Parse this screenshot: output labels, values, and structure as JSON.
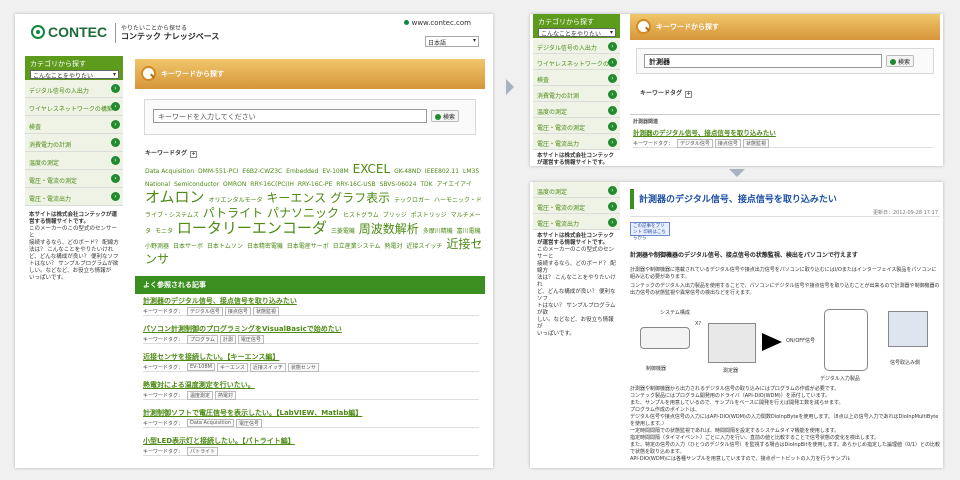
{
  "brand": {
    "logo": "CONTEC",
    "tagline_small": "やりたいことから探せる",
    "tagline": "コンテック ナレッジベース",
    "url": "www.contec.com",
    "language": "日本語"
  },
  "sidebar": {
    "title": "カテゴリから探す",
    "select": "こんなことをやりたい",
    "items": [
      "デジタル信号の入出力",
      "ワイヤレスネットワークの構築",
      "検査",
      "消費電力の計測",
      "温度の測定",
      "電圧・電流の測定",
      "電圧・電流出力"
    ],
    "about_title": "本サイトは株式会社コンテックが運営する情報サイトです。",
    "about_lines": [
      "このメーカーのこの型式のセンサーと",
      "接続するなら、どのボード？ 配線方",
      "法は？ こんなことをやりたいけれ",
      "ど、どんな構成が良い？ 便利なソフ",
      "トはない？ サンプルプログラムが欲",
      "しい。などなど、お役立ち情報が",
      "いっぱいです。"
    ]
  },
  "search": {
    "title": "キーワードから探す",
    "placeholder": "キーワードを入力してください",
    "button": "検索",
    "s2_value": "計測器",
    "tag_heading": "キーワードタグ",
    "toggle": "+"
  },
  "tag_cloud": [
    {
      "t": "Data Acquisition",
      "s": 1
    },
    {
      "t": "DMM-551-PCI",
      "s": 1
    },
    {
      "t": "E6B2-CWZ3C",
      "s": 1
    },
    {
      "t": "Embedded",
      "s": 1
    },
    {
      "t": "EV-108M",
      "s": 1
    },
    {
      "t": "EXCEL",
      "s": 3
    },
    {
      "t": "GK-48ND",
      "s": 1
    },
    {
      "t": "IEEE802.11",
      "s": 1
    },
    {
      "t": "LM35",
      "s": 1
    },
    {
      "t": "National",
      "s": 1
    },
    {
      "t": "Semiconductor",
      "s": 1
    },
    {
      "t": "OMRON",
      "s": 1
    },
    {
      "t": "RRY-16C(PCI)H",
      "s": 1
    },
    {
      "t": "RRY-16C-PE",
      "s": 1
    },
    {
      "t": "RRY-16C-USB",
      "s": 1
    },
    {
      "t": "SBVS-06024",
      "s": 1
    },
    {
      "t": "TDK",
      "s": 1
    },
    {
      "t": "アイエイアイ",
      "s": 1
    },
    {
      "t": "オムロン",
      "s": 4
    },
    {
      "t": "オリエンタルモータ",
      "s": 1
    },
    {
      "t": "キーエンス",
      "s": 3
    },
    {
      "t": "グラフ表示",
      "s": 3
    },
    {
      "t": "テックロガー",
      "s": 1
    },
    {
      "t": "ハーモニック・ドライブ・システムズ",
      "s": 1
    },
    {
      "t": "パトライト",
      "s": 3
    },
    {
      "t": "パナソニック",
      "s": 3
    },
    {
      "t": "ヒストグラム",
      "s": 1
    },
    {
      "t": "ブリッジ",
      "s": 1
    },
    {
      "t": "ポストリッジ",
      "s": 1
    },
    {
      "t": "マルチメータ",
      "s": 1
    },
    {
      "t": "モニタ",
      "s": 1
    },
    {
      "t": "ロータリーエンコーダ",
      "s": 4
    },
    {
      "t": "三菱電機",
      "s": 1
    },
    {
      "t": "周波数解析",
      "s": 3
    },
    {
      "t": "多摩川精機",
      "s": 1
    },
    {
      "t": "富川電機",
      "s": 1
    },
    {
      "t": "小野測器",
      "s": 1
    },
    {
      "t": "日本サーボ",
      "s": 1
    },
    {
      "t": "日本トムソン",
      "s": 1
    },
    {
      "t": "日本精密電機",
      "s": 1
    },
    {
      "t": "日本電産サーボ",
      "s": 1
    },
    {
      "t": "日立産業システム",
      "s": 1
    },
    {
      "t": "熱電対",
      "s": 1
    },
    {
      "t": "近接スイッチ",
      "s": 1
    },
    {
      "t": "近接センサ",
      "s": 3
    }
  ],
  "popular": {
    "heading": "よく参照される記事",
    "tag_label": "キーワードタグ：",
    "articles": [
      {
        "title": "計測器のデジタル信号、接点信号を取り込みたい",
        "tags": [
          "デジタル信号",
          "接点信号",
          "状態監視"
        ]
      },
      {
        "title": "パソコン計測制御のプログラミングをVisualBasicで始めたい",
        "tags": [
          "プログラム",
          "計測",
          "電圧信号"
        ]
      },
      {
        "title": "近接センサを接続したい。【キーエンス編】",
        "tags": [
          "EV-108M",
          "キーエンス",
          "近接スイッチ",
          "状態センサ"
        ]
      },
      {
        "title": "熱電対による温度測定を行いたい。",
        "tags": [
          "温度測定",
          "熱電対"
        ]
      },
      {
        "title": "計測制御ソフトで電圧信号を表示したい。【LabVIEW、Matlab編】",
        "tags": [
          "Data Acquisition",
          "電圧信号"
        ]
      },
      {
        "title": "小型LED表示灯と接続したい。【パトライト編】",
        "tags": [
          "パトライト"
        ]
      }
    ]
  },
  "result_list": {
    "header": "計測器関連",
    "title": "計測器のデジタル信号、接点信号を取り込みたい",
    "tags": [
      "デジタル信号",
      "接点信号",
      "状態監視"
    ]
  },
  "article": {
    "title": "計測器のデジタル信号、接点信号を取り込みたい",
    "date": "更新日：2012-09-28 17:17",
    "print_button": "この記事をプリント 印刷はこちらから",
    "intro": "計測器や制御機器のデジタル信号、接点信号の状態監視、検出をパソコンで行えます",
    "paragraphs": [
      "計測器や制御機器に搭載されているデジタル信号や接点出力信号をパソコンに取り込むにはI/Oまたはインターフェイス製品をパソコンに組み込む必要があります。",
      "コンテックのデジタル入出力製品を使用することで、パソコンにデジタル信号や接点信号を取り込むことが出来るので計測器や制御機器の出力信号の状態監視や異常信号の検出などを行えます。"
    ],
    "diagram": {
      "label_system": "システム構成",
      "label_device": "制御機器",
      "label_meter": "測定器",
      "label_onoff": "ON/OFF信号",
      "label_board": "デジタル入力製品",
      "label_pc": "信号取込み側",
      "label_x": "X?"
    },
    "paragraphs2": [
      "計測器や制御機器から出力されるデジタル信号の取り込みにはプログラムの作成が必要です。",
      "コンテック製品にはプログラム開発用のドライバ（API-DIO(WDM)）を添付しています。",
      "また、サンプルを用意しているので、サンプルをベースに開発を行えば開発工数を減らせます。",
      "プログラム作成のポイントは、",
      "デジタル信号や接点信号の入力にはAPI-DIO(WDM)の入力関数DioInpByteを使用します。（8点以上の信号入力であればDioInpMultiByteを使用します。）",
      "一定時間間隔での状態監視であれば、時間間隔を設定するシステムタイマ機能を使用します。",
      "指定時間間隔（タイマイベント）ごとに入力を行い、直前の値と比較することで信号状態の変化を検出します。",
      "また、特定の信号の入力（ひとつのデジタル信号）を監視する場合はDioInpBitを使用します。あらかじめ指定した論理値（0/1）との比較で状態を取り込めます。",
      "API-DIO(WDM)には各種サンプルを用意していますので、接点ポートビットの入力を行うサンプル"
    ]
  },
  "colors": {
    "green": "#3b8f20",
    "link": "#4c8a14",
    "orange": "#d7953a",
    "blue_title": "#1b4ea6"
  }
}
